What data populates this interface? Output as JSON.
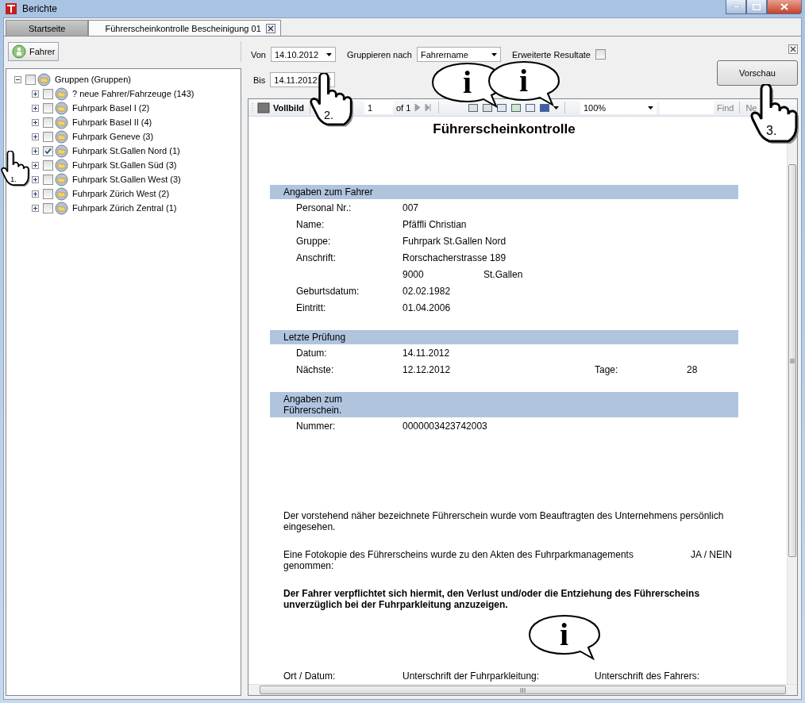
{
  "window": {
    "title": "Berichte"
  },
  "tabs": [
    {
      "label": "Startseite",
      "selected": false
    },
    {
      "label": "Führerscheinkontrolle Bescheinigung 01",
      "selected": true
    }
  ],
  "sidebar": {
    "button": "Fahrer",
    "tree": {
      "label": "Gruppen (Gruppen)",
      "expanded": true,
      "checked": false,
      "children": [
        {
          "label": "? neue Fahrer/Fahrzeuge (143)",
          "expanded": false,
          "checked": false
        },
        {
          "label": "Fuhrpark Basel I (2)",
          "expanded": false,
          "checked": false
        },
        {
          "label": "Fuhrpark Basel II (4)",
          "expanded": false,
          "checked": false
        },
        {
          "label": "Fuhrpark Geneve (3)",
          "expanded": false,
          "checked": false
        },
        {
          "label": "Fuhrpark St.Gallen Nord (1)",
          "expanded": false,
          "checked": true
        },
        {
          "label": "Fuhrpark St.Gallen Süd (3)",
          "expanded": false,
          "checked": false
        },
        {
          "label": "Fuhrpark St.Gallen West (3)",
          "expanded": false,
          "checked": false
        },
        {
          "label": "Fuhrpark Zürich West (2)",
          "expanded": false,
          "checked": false
        },
        {
          "label": "Fuhrpark Zürich Zentral (1)",
          "expanded": false,
          "checked": false
        }
      ]
    }
  },
  "filters": {
    "von": {
      "label": "Von",
      "value": "14.10.2012"
    },
    "gruppieren": {
      "label": "Gruppieren nach",
      "value": "Fahrername"
    },
    "erweitert": {
      "label": "Erweiterte Resultate",
      "checked": false
    },
    "bis": {
      "label": "Bis",
      "value": "14.11.2012"
    },
    "preview_button": "Vorschau"
  },
  "viewer_toolbar": {
    "fullscreen": "Vollbild",
    "page": "1",
    "page_of": "of 1",
    "zoom": "100%",
    "find": "Find",
    "next": "Ne"
  },
  "report": {
    "title": "Führerscheinkontrolle",
    "sections": [
      {
        "title": "Angaben zum Fahrer",
        "rows": [
          {
            "label": "Personal Nr.:",
            "value": "007"
          },
          {
            "label": "Name:",
            "value": "Pfäffli Christian"
          },
          {
            "label": "Gruppe:",
            "value": "Fuhrpark St.Gallen Nord"
          },
          {
            "label": "Anschrift:",
            "value": "Rorschacherstrasse 189"
          },
          {
            "value": "9000",
            "city": "St.Gallen"
          },
          {
            "label": "Geburtsdatum:",
            "value": "02.02.1982"
          },
          {
            "label": "Eintritt:",
            "value": "01.04.2006"
          }
        ]
      },
      {
        "title": "Letzte Prüfung",
        "rows": [
          {
            "label": "Datum:",
            "value": "14.11.2012"
          },
          {
            "label": "Nächste:",
            "value": "12.12.2012",
            "label_2": "Tage:",
            "value_2": "28"
          }
        ]
      },
      {
        "title": "Angaben zum Führerschein.",
        "rows": [
          {
            "label": "Nummer:",
            "value": "0000003423742003"
          }
        ]
      }
    ],
    "paragraphs": [
      {
        "text": "Der vorstehend näher bezeichnete Führerschein wurde vom Beauftragten des Unternehmens persönlich eingesehen.",
        "bold": false
      },
      {
        "text": "Eine Fotokopie des Führerscheins wurde zu den Akten des Fuhrparkmanagements genommen:",
        "bold": false,
        "answer": "JA / NEIN"
      },
      {
        "text": "Der Fahrer verpflichtet sich hiermit, den Verlust und/oder die Entziehung des Führerscheins unverzüglich bei der Fuhrparkleitung anzuzeigen.",
        "bold": true
      }
    ],
    "signatures": [
      "Ort / Datum:",
      "Unterschrift der Fuhrparkleitung:",
      "Unterschrift des Fahrers:"
    ]
  },
  "annotations": {
    "pointers": [
      {
        "label": "1."
      },
      {
        "label": "2."
      },
      {
        "label": "3."
      }
    ],
    "info_bubbles": [
      {
        "label": "i"
      },
      {
        "label": "i"
      },
      {
        "label": "i"
      }
    ]
  }
}
